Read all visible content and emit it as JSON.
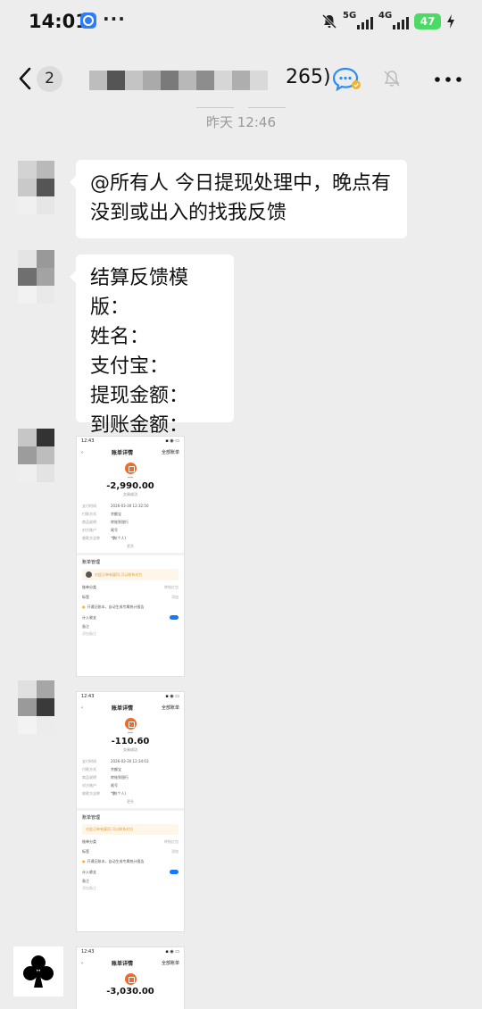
{
  "status_bar": {
    "time": "14:01",
    "more": "···",
    "signal_1": "5G",
    "signal_2": "4G",
    "battery": "47"
  },
  "nav": {
    "unread_count": "2",
    "member_count": "265)"
  },
  "timestamp": "昨天 12:46",
  "messages": [
    {
      "text_line1": "@所有人 今日提现处理中，晚点有",
      "text_line2": "没到或出入的找我反馈"
    },
    {
      "lines": [
        "结算反馈模版：",
        "姓名：",
        "支付宝：",
        "提现金额：",
        "到账金额："
      ]
    }
  ],
  "shots": [
    {
      "time": "12:43",
      "title": "账单详情",
      "all": "全部账单",
      "payee": "***",
      "amount": "-2,990.00",
      "state": "交易成功",
      "rows": [
        [
          "支付时间",
          "2026-03-30 12:32:50"
        ],
        [
          "付款方式",
          "余额宝"
        ],
        [
          "商品说明",
          "转账到银行"
        ],
        [
          "对方账户",
          "尾号"
        ],
        [
          "收款方全称",
          "*鹏(个人)"
        ]
      ],
      "more": "更多",
      "section": "账单管理",
      "note": "对此订单有疑问,可以联系对方",
      "cat_label": "账单分类",
      "cat_value": "转账红包",
      "tag_label": "标签",
      "tag_value": "添加",
      "tip": "开通记账本，自动生成专属统计报告",
      "count_label": "计入收支",
      "remark_label": "备注",
      "remark_ph": "添加备注"
    },
    {
      "time": "12:43",
      "title": "账单详情",
      "all": "全部账单",
      "payee": "***",
      "amount": "-110.60",
      "state": "交易成功",
      "rows": [
        [
          "支付时间",
          "2026-03-30 12:34:03"
        ],
        [
          "付款方式",
          "余额宝"
        ],
        [
          "商品说明",
          "转账到银行"
        ],
        [
          "对方账户",
          "尾号"
        ],
        [
          "收款方全称",
          "*鹏(个人)"
        ]
      ],
      "more": "更多",
      "section": "账单管理",
      "note": "对此订单有疑问,可以联系对方",
      "cat_label": "账单分类",
      "cat_value": "转账红包",
      "tag_label": "标签",
      "tag_value": "添加",
      "tip": "开通记账本，自动生成专属统计报告",
      "count_label": "计入收支",
      "remark_label": "备注",
      "remark_ph": "添加备注"
    },
    {
      "time": "12:43",
      "title": "账单详情",
      "all": "全部账单",
      "amount": "-3,030.00"
    }
  ],
  "colors": {
    "background": "#ededed",
    "bubble": "#ffffff",
    "battery": "#4cd964",
    "alipay_orange": "#ef6a2b",
    "toggle_blue": "#1677ff"
  },
  "icons": [
    "app-icon",
    "back-chevron-icon",
    "chat-bubble-icon",
    "mute-bell-icon",
    "more-icon",
    "club-icon"
  ]
}
